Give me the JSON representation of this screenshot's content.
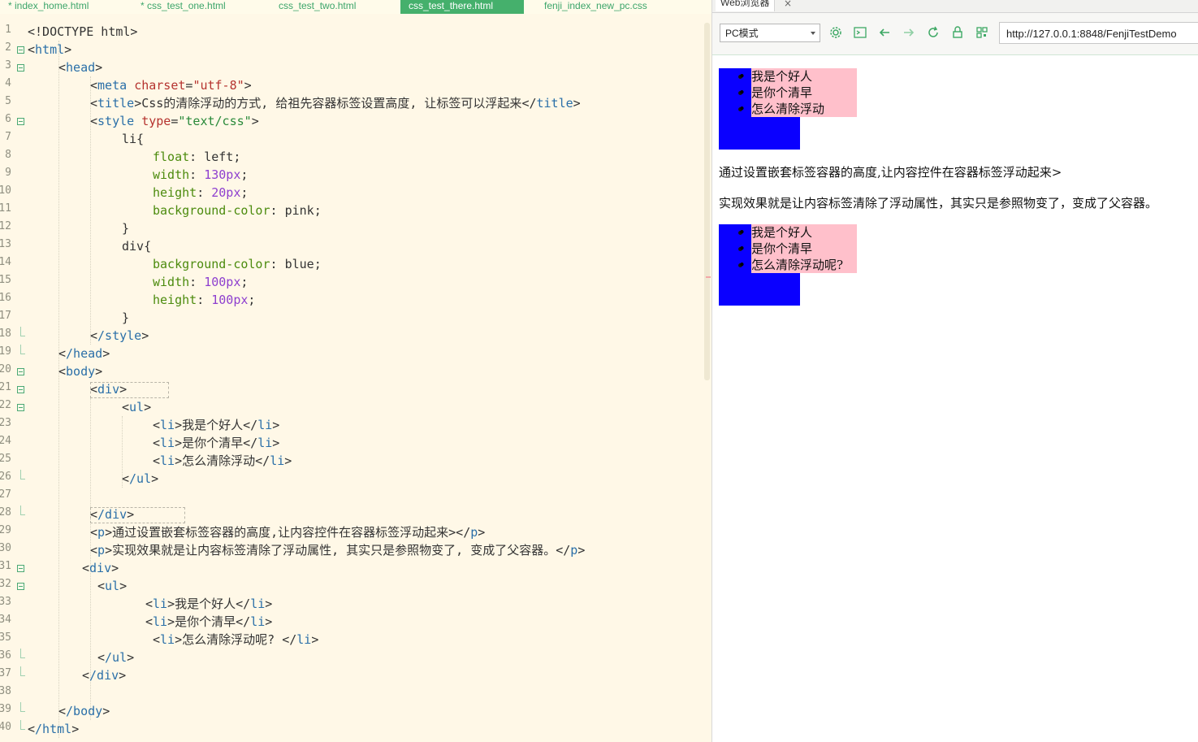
{
  "editor": {
    "tabs": [
      {
        "label": "* index_home.html",
        "active": false
      },
      {
        "label": "* css_test_one.html",
        "active": false
      },
      {
        "label": "css_test_two.html",
        "active": false
      },
      {
        "label": "css_test_there.html",
        "active": true
      },
      {
        "label": "fenji_index_new_pc.css",
        "active": false
      }
    ],
    "line_numbers": [
      "1",
      "2",
      "3",
      "4",
      "5",
      "6",
      "7",
      "8",
      "9",
      "10",
      "11",
      "12",
      "13",
      "14",
      "15",
      "16",
      "17",
      "18",
      "19",
      "20",
      "21",
      "22",
      "23",
      "24",
      "25",
      "26",
      "27",
      "28",
      "29",
      "30",
      "31",
      "32",
      "33",
      "34",
      "35",
      "36",
      "37",
      "38",
      "39",
      "40"
    ],
    "code": {
      "l1": "<!DOCTYPE html>",
      "l2_open": "<",
      "l2_tag": "html",
      "l2_close": ">",
      "l3_tag": "head",
      "l4_tag": "meta",
      "l4_attr": "charset",
      "l4_val": "\"utf-8\"",
      "l5_tag": "title",
      "l5_text": "Css的清除浮动的方式, 给祖先容器标签设置高度, 让标签可以浮起来",
      "l6_tag": "style",
      "l6_attr": "type",
      "l6_val": "\"text/css\"",
      "l7": "li{",
      "l8_prop": "float",
      "l8_val": "left",
      "l9_prop": "width",
      "l9_val": "130px",
      "l10_prop": "height",
      "l10_val": "20px",
      "l11_prop": "background-color",
      "l11_val": "pink",
      "l12": "}",
      "l13": "div{",
      "l14_prop": "background-color",
      "l14_val": "blue",
      "l15_prop": "width",
      "l15_val": "100px",
      "l16_prop": "height",
      "l16_val": "100px",
      "l17": "}",
      "l18_tag": "/style",
      "l19_tag": "/head",
      "l20_tag": "body",
      "l21_tag": "div",
      "l22_tag": "ul",
      "l23_text": "我是个好人",
      "l24_text": "是你个清早",
      "l25_text": "怎么清除浮动",
      "l26_tag": "/ul",
      "l28_tag": "/div",
      "l29_text": "通过设置嵌套标签容器的高度,让内容控件在容器标签浮动起来>",
      "l30_text": "实现效果就是让内容标签清除了浮动属性, 其实只是参照物变了, 变成了父容器。",
      "l31_tag": "div",
      "l32_tag": "ul",
      "l33_text": "我是个好人",
      "l34_text": "是你个清早",
      "l35_text": "怎么清除浮动呢? ",
      "l36_tag": "/ul",
      "l37_tag": "/div",
      "l39_tag": "/body",
      "l40_tag": "/html",
      "li": "li",
      "p": "p"
    }
  },
  "browser": {
    "tab_label": "Web浏览器",
    "tab_close": "×",
    "mode_label": "PC模式",
    "url": "http://127.0.0.1:8848/FenjiTestDemo",
    "icons": [
      "settings-icon",
      "terminal-icon",
      "back-arrow-icon",
      "forward-arrow-icon",
      "refresh-icon",
      "lock-icon",
      "qrcode-icon"
    ],
    "page": {
      "block1": [
        "我是个好人",
        "是你个清早",
        "怎么清除浮动"
      ],
      "p1": "通过设置嵌套标签容器的高度,让内容控件在容器标签浮动起来>",
      "p2": "实现效果就是让内容标签清除了浮动属性，其实只是参照物变了，变成了父容器。",
      "block2": [
        "我是个好人",
        "是你个清早",
        "怎么清除浮动呢?"
      ]
    }
  },
  "colors": {
    "accent_green": "#45b06c",
    "demo_blue": "#0a00ff",
    "demo_pink": "#ffc0cb",
    "editor_bg": "#fff8e7"
  }
}
